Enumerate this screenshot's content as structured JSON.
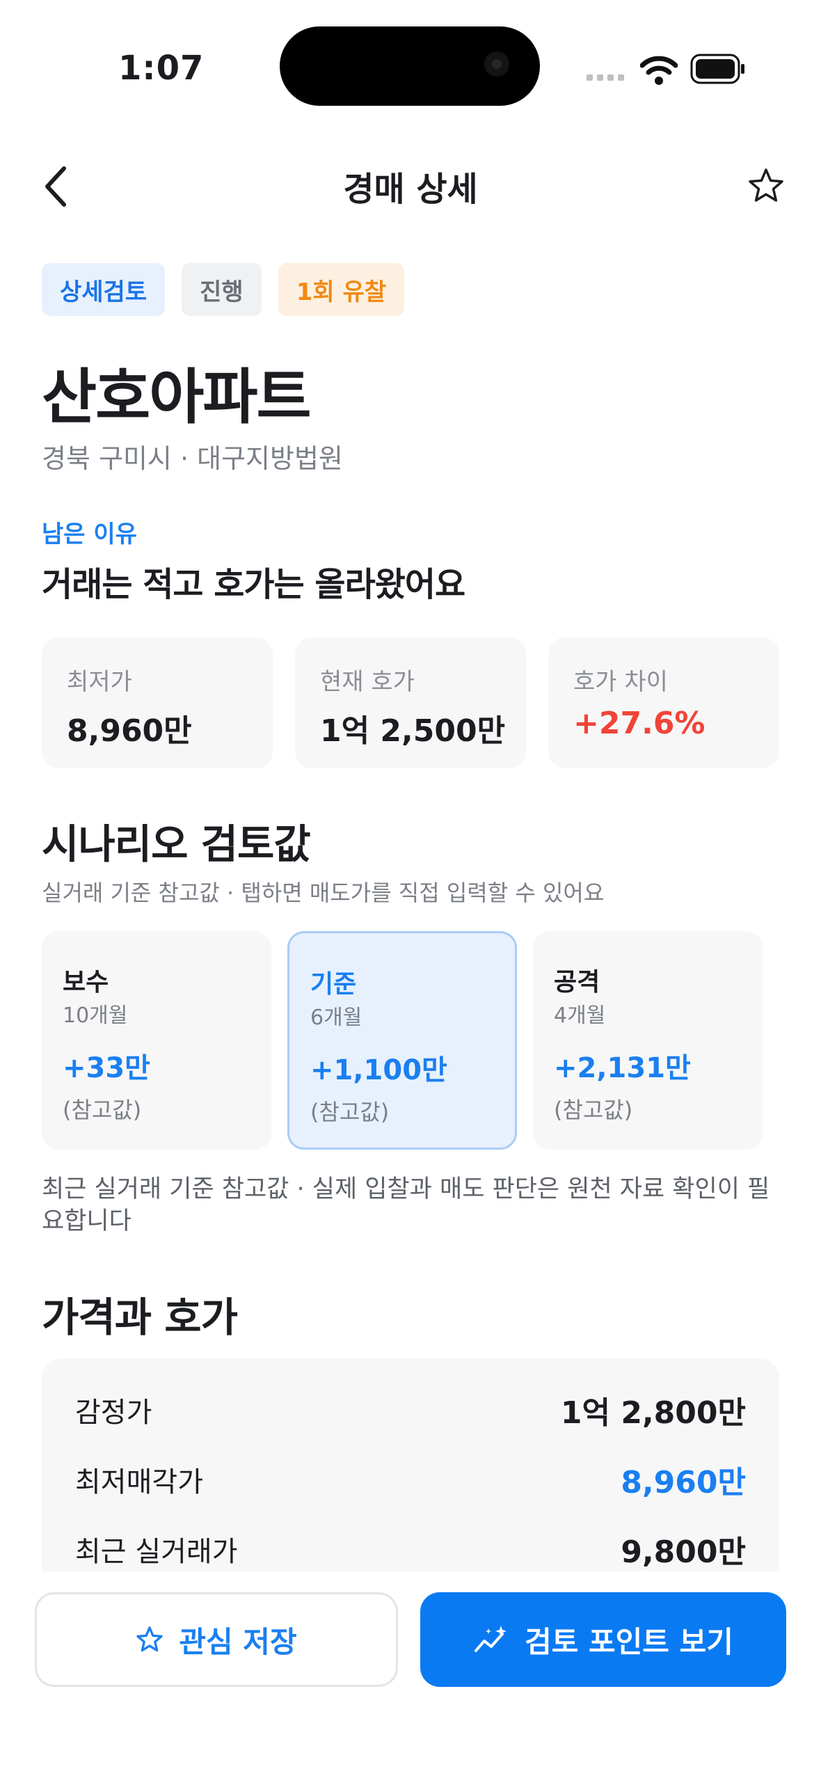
{
  "status": {
    "time": "1:07"
  },
  "header": {
    "title": "경매 상세"
  },
  "badges": [
    {
      "label": "상세검토"
    },
    {
      "label": "진행"
    },
    {
      "label": "1회 유찰"
    }
  ],
  "property": {
    "name": "산호아파트",
    "location": "경북 구미시 · 대구지방법원"
  },
  "reason": {
    "label": "남은 이유",
    "text": "거래는 적고 호가는 올라왔어요"
  },
  "stats": [
    {
      "label": "최저가",
      "value": "8,960만"
    },
    {
      "label": "현재 호가",
      "value": "1억 2,500만"
    },
    {
      "label": "호가 차이",
      "value": "+27.6%"
    }
  ],
  "scenario": {
    "title": "시나리오 검토값",
    "subtitle": "실거래 기준 참고값 · 탭하면 매도가를 직접 입력할 수 있어요",
    "cards": [
      {
        "name": "보수",
        "period": "10개월",
        "value": "+33만",
        "note": "(참고값)"
      },
      {
        "name": "기준",
        "period": "6개월",
        "value": "+1,100만",
        "note": "(참고값)",
        "selected": true
      },
      {
        "name": "공격",
        "period": "4개월",
        "value": "+2,131만",
        "note": "(참고값)"
      }
    ],
    "disclaimer": "최근 실거래 기준 참고값 · 실제 입찰과 매도 판단은 원천 자료 확인이 필요합니다"
  },
  "prices": {
    "title": "가격과 호가",
    "rows": [
      {
        "label": "감정가",
        "value": "1억 2,800만"
      },
      {
        "label": "최저매각가",
        "value": "8,960만"
      },
      {
        "label": "최근 실거래가",
        "value": "9,800만"
      }
    ]
  },
  "actions": {
    "save_label": "관심 저장",
    "review_label": "검토 포인트 보기"
  },
  "colors": {
    "accent": "#0a7af3",
    "negative": "#f04438",
    "warning": "#f08a12"
  }
}
